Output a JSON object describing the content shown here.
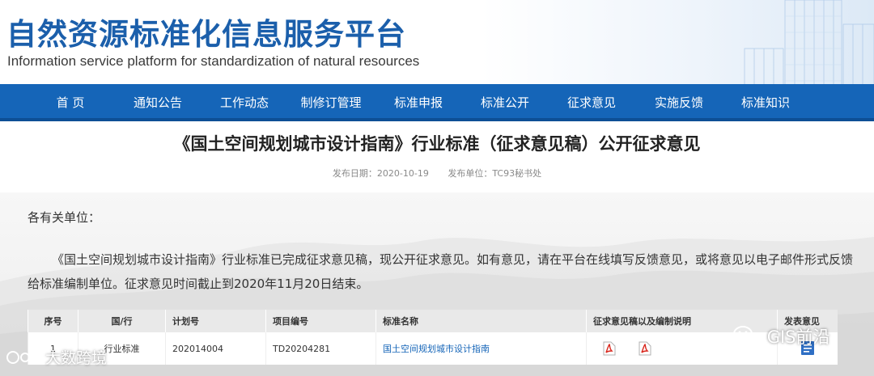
{
  "header": {
    "title_cn": "自然资源标准化信息服务平台",
    "title_en": "Information service platform for standardization of natural resources"
  },
  "nav": {
    "items": [
      "首 页",
      "通知公告",
      "工作动态",
      "制修订管理",
      "标准申报",
      "标准公开",
      "征求意见",
      "实施反馈",
      "标准知识"
    ]
  },
  "article": {
    "title": "《国土空间规划城市设计指南》行业标准（征求意见稿）公开征求意见",
    "publish_date": "发布日期：2020-10-19",
    "publisher": "发布单位：TC93秘书处",
    "greeting": "各有关单位：",
    "body": "《国土空间规划城市设计指南》行业标准已完成征求意见稿，现公开征求意见。如有意见，请在平台在线填写反馈意见，或将意见以电子邮件形式反馈给标准编制单位。征求意见时间截止到2020年11月20日结束。"
  },
  "table": {
    "headers": [
      "序号",
      "国/行",
      "计划号",
      "项目编号",
      "标准名称",
      "征求意见稿以及编制说明",
      "发表意见"
    ],
    "row": {
      "index": "1",
      "level": "行业标准",
      "plan_no": "202014004",
      "project_no": "TD20204281",
      "name": "国土空间规划城市设计指南"
    }
  },
  "watermarks": {
    "left": "大数跨境",
    "right": "GIS前沿"
  },
  "colors": {
    "brand_blue": "#1565b8",
    "title_blue": "#1b5fab",
    "pdf_red": "#d9261c"
  },
  "icons": {
    "pdf": "pdf-file-icon",
    "feedback": "feedback-form-icon",
    "wechat": "wechat-icon",
    "weibo": "weibo-icon"
  }
}
